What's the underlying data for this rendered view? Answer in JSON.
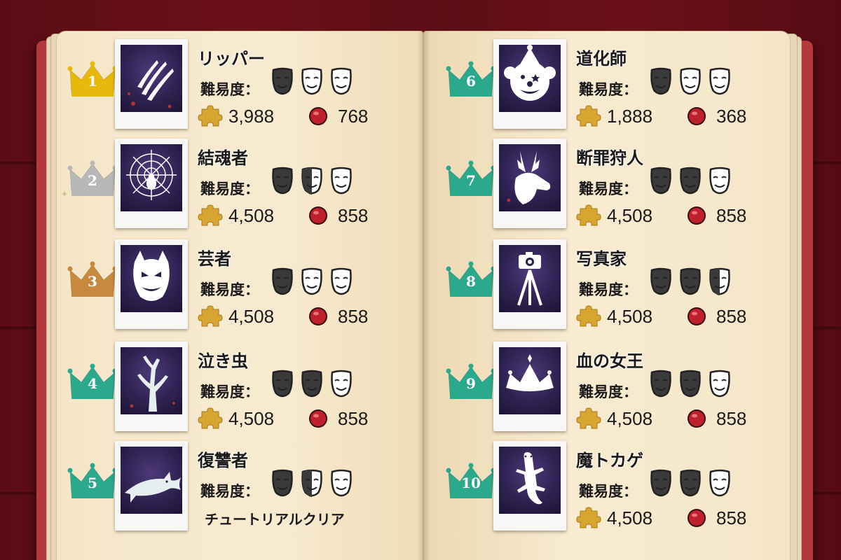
{
  "difficulty_label": "難易度：",
  "colors": {
    "gold": "#e8b80a",
    "silver": "#b8b8b8",
    "bronze": "#c8893e",
    "teal": "#2aa98d",
    "mask_dark": "#3a3a3a",
    "mask_light": "#ffffff"
  },
  "entries": [
    {
      "rank": "1",
      "name": "リッパー",
      "crown": "gold",
      "icon": "claw-marks-icon",
      "masks": [
        "dark",
        "light",
        "light"
      ],
      "pieces": "3,988",
      "rubies": "768"
    },
    {
      "rank": "2",
      "name": "結魂者",
      "crown": "silver",
      "icon": "spider-web-icon",
      "masks": [
        "dark",
        "half",
        "light"
      ],
      "pieces": "4,508",
      "rubies": "858"
    },
    {
      "rank": "3",
      "name": "芸者",
      "crown": "bronze",
      "icon": "hannya-mask-icon",
      "masks": [
        "dark",
        "light",
        "light"
      ],
      "pieces": "4,508",
      "rubies": "858"
    },
    {
      "rank": "4",
      "name": "泣き虫",
      "crown": "teal",
      "icon": "dead-tree-icon",
      "masks": [
        "dark",
        "dark",
        "light"
      ],
      "pieces": "4,508",
      "rubies": "858"
    },
    {
      "rank": "5",
      "name": "復讐者",
      "crown": "teal",
      "icon": "shark-icon",
      "masks": [
        "dark",
        "half",
        "light"
      ],
      "clear_text": "チュートリアルクリア"
    },
    {
      "rank": "6",
      "name": "道化師",
      "crown": "teal",
      "icon": "clown-face-icon",
      "masks": [
        "dark",
        "light",
        "light"
      ],
      "pieces": "1,888",
      "rubies": "368"
    },
    {
      "rank": "7",
      "name": "断罪狩人",
      "crown": "teal",
      "icon": "deer-head-icon",
      "masks": [
        "dark",
        "dark",
        "light"
      ],
      "pieces": "4,508",
      "rubies": "858"
    },
    {
      "rank": "8",
      "name": "写真家",
      "crown": "teal",
      "icon": "camera-tripod-icon",
      "masks": [
        "dark",
        "dark",
        "half"
      ],
      "pieces": "4,508",
      "rubies": "858"
    },
    {
      "rank": "9",
      "name": "血の女王",
      "crown": "teal",
      "icon": "queen-crown-icon",
      "masks": [
        "dark",
        "dark",
        "light"
      ],
      "pieces": "4,508",
      "rubies": "858"
    },
    {
      "rank": "10",
      "name": "魔トカゲ",
      "crown": "teal",
      "icon": "lizard-icon",
      "masks": [
        "dark",
        "dark",
        "light"
      ],
      "pieces": "4,508",
      "rubies": "858"
    }
  ]
}
